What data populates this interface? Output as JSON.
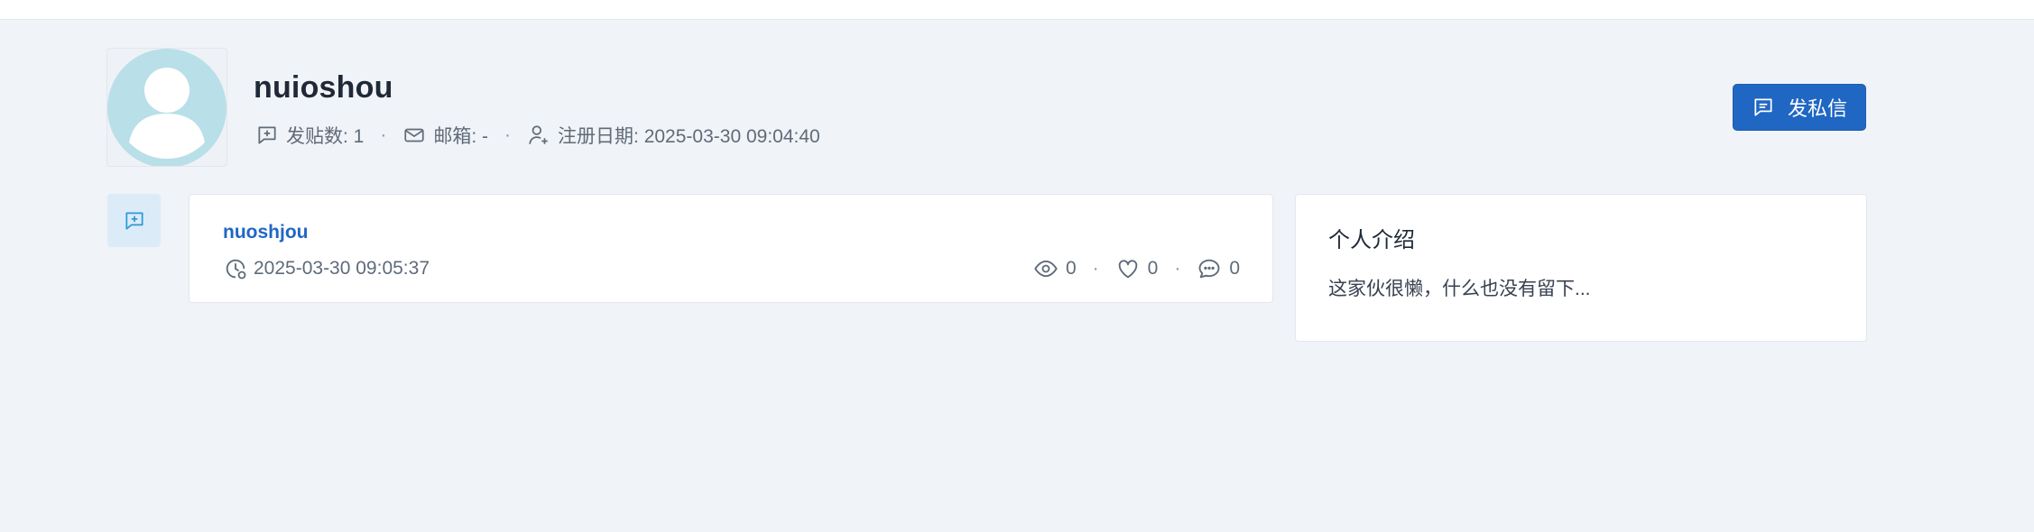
{
  "profile": {
    "username": "nuioshou",
    "posts_label": "发贴数: 1",
    "email_label": "邮箱: -",
    "register_label": "注册日期: 2025-03-30 09:04:40",
    "pm_button": "发私信"
  },
  "posts": [
    {
      "title": "nuoshjou",
      "date": "2025-03-30 09:05:37",
      "views": "0",
      "likes": "0",
      "comments": "0"
    }
  ],
  "intro": {
    "title": "个人介绍",
    "text": "这家伙很懒，什么也没有留下..."
  },
  "colors": {
    "accent": "#2067c4",
    "background": "#f0f3f7",
    "avatar": "#b9dfe8"
  },
  "icons": [
    "post-add-icon",
    "mail-icon",
    "user-add-icon",
    "message-icon",
    "clock-icon",
    "eye-icon",
    "heart-icon",
    "comment-icon"
  ]
}
